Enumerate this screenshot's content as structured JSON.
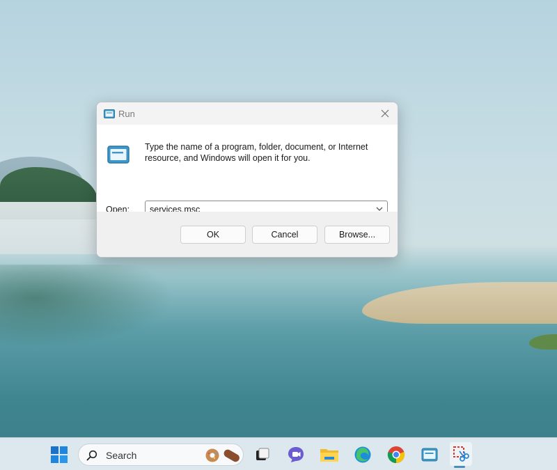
{
  "dialog": {
    "title": "Run",
    "title_icon": "run-icon",
    "description": "Type the name of a program, folder, document, or Internet resource, and Windows will open it for you.",
    "open_label": "Open:",
    "open_value": "services.msc",
    "buttons": {
      "ok": "OK",
      "cancel": "Cancel",
      "browse": "Browse..."
    }
  },
  "taskbar": {
    "search_placeholder": "Search",
    "items": [
      {
        "name": "start-icon"
      },
      {
        "name": "search-input"
      },
      {
        "name": "task-view-icon"
      },
      {
        "name": "teams-chat-icon"
      },
      {
        "name": "file-explorer-icon"
      },
      {
        "name": "edge-icon"
      },
      {
        "name": "chrome-icon"
      },
      {
        "name": "run-icon"
      },
      {
        "name": "snipping-tool-icon"
      }
    ]
  },
  "colors": {
    "accent": "#4a8fb8",
    "dialog_bg": "#ffffff",
    "footer_bg": "#f0f0f0",
    "taskbar_bg": "#dce8ee"
  }
}
